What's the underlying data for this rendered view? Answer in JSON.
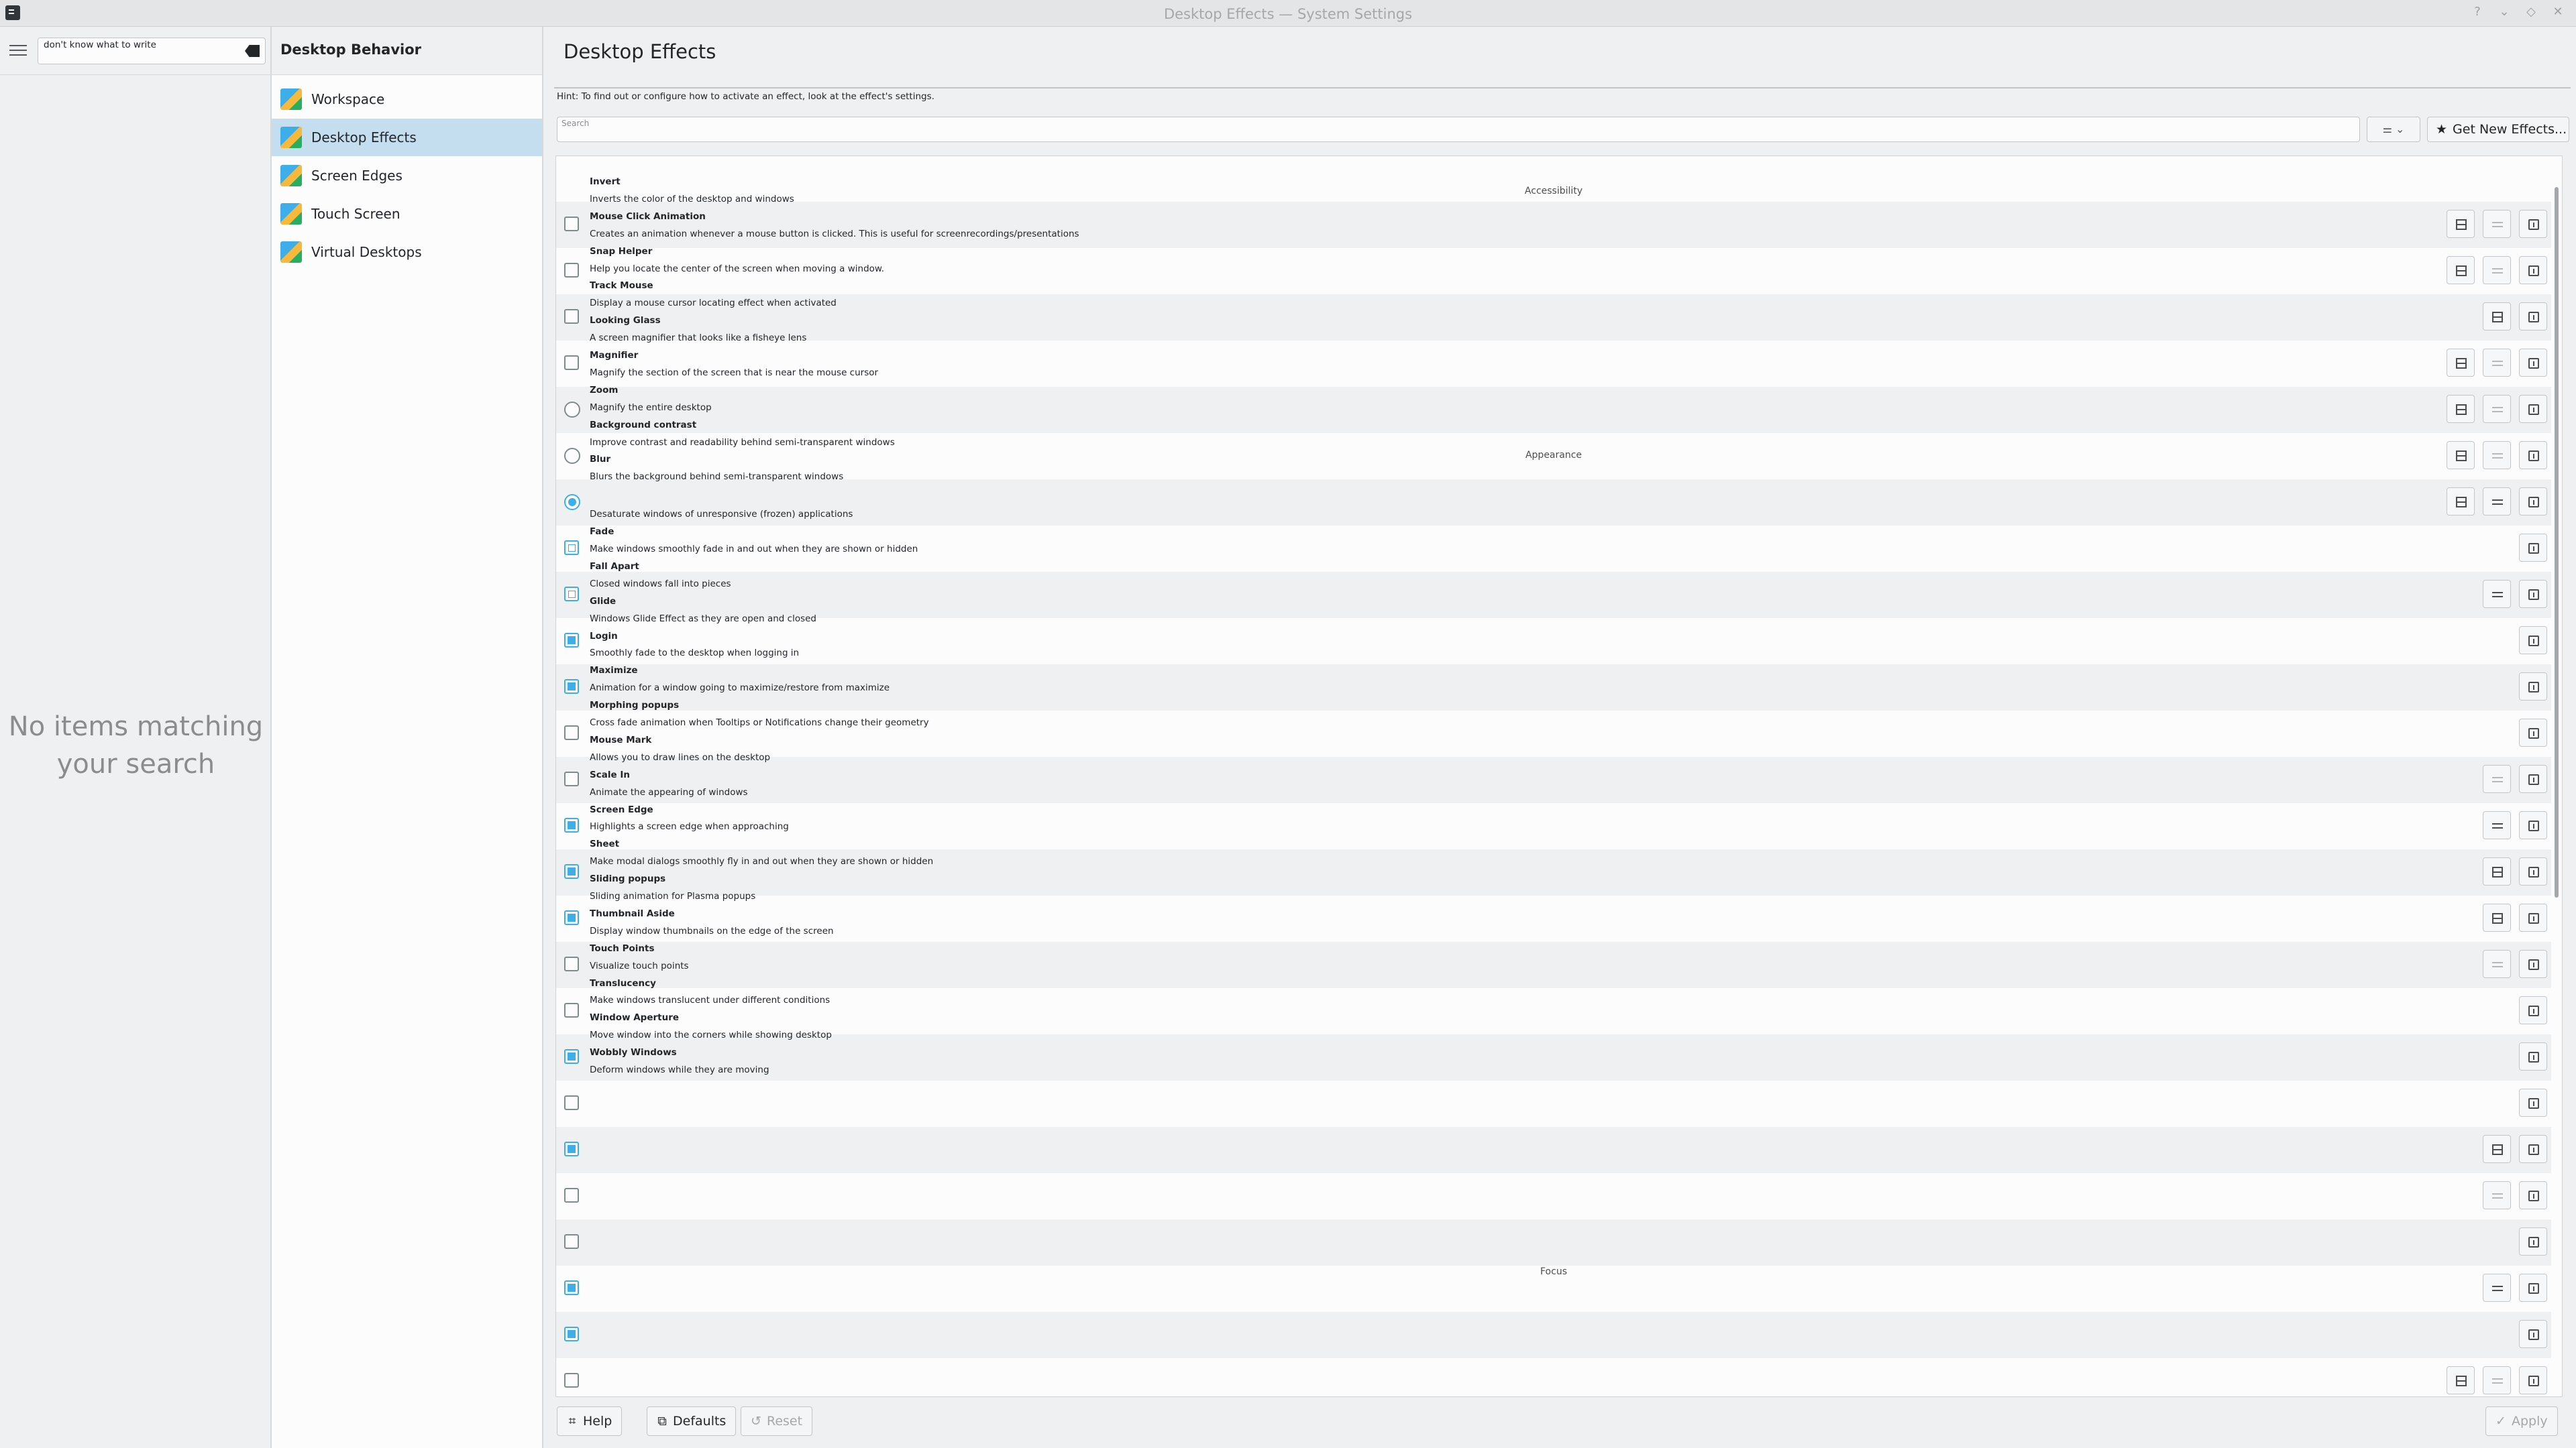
{
  "window": {
    "title": "Desktop Effects — System Settings",
    "controls": [
      "?",
      "⌄",
      "◇",
      "✕"
    ]
  },
  "sidebar": {
    "search_value": "don't know what to write",
    "no_items": "No items matching your search"
  },
  "categories": {
    "header": "Desktop Behavior",
    "items": [
      {
        "label": "Workspace",
        "selected": false
      },
      {
        "label": "Desktop Effects",
        "selected": true
      },
      {
        "label": "Screen Edges",
        "selected": false
      },
      {
        "label": "Touch Screen",
        "selected": false
      },
      {
        "label": "Virtual Desktops",
        "selected": false
      }
    ]
  },
  "main": {
    "title": "Desktop Effects",
    "hint": "Hint: To find out or configure how to activate an effect, look at the effect's settings.",
    "search_placeholder": "Search",
    "filter_glyph": "⚌ ⌄",
    "get_new_label": "Get New Effects...",
    "get_new_icon": "★"
  },
  "sections": {
    "accessibility": "Accessibility",
    "appearance": "Appearance",
    "focus": "Focus"
  },
  "texts": [
    {
      "text": "Invert",
      "bold": true
    },
    {
      "text": "Inverts the color of the desktop and windows",
      "bold": false
    },
    {
      "text": "Mouse Click Animation",
      "bold": true
    },
    {
      "text": "Creates an animation whenever a mouse button is clicked. This is useful for screenrecordings/presentations",
      "bold": false
    },
    {
      "text": "Snap Helper",
      "bold": true
    },
    {
      "text": "Help you locate the center of the screen when moving a window.",
      "bold": false
    },
    {
      "text": "Track Mouse",
      "bold": true
    },
    {
      "text": "Display a mouse cursor locating effect when activated",
      "bold": false
    },
    {
      "text": "Looking Glass",
      "bold": true
    },
    {
      "text": "A screen magnifier that looks like a fisheye lens",
      "bold": false
    },
    {
      "text": "Magnifier",
      "bold": true
    },
    {
      "text": "Magnify the section of the screen that is near the mouse cursor",
      "bold": false
    },
    {
      "text": "Zoom",
      "bold": true
    },
    {
      "text": "Magnify the entire desktop",
      "bold": false
    },
    {
      "text": "Background contrast",
      "bold": true
    },
    {
      "text": "Improve contrast and readability behind semi-transparent windows",
      "bold": false
    },
    {
      "text": "Blur",
      "bold": true
    },
    {
      "text": "Blurs the background behind semi-transparent windows",
      "bold": false
    },
    {
      "text": "Desaturate windows of unresponsive (frozen) applications",
      "bold": false
    },
    {
      "text": "Fade",
      "bold": true
    },
    {
      "text": "Make windows smoothly fade in and out when they are shown or hidden",
      "bold": false
    },
    {
      "text": "Fall Apart",
      "bold": true
    },
    {
      "text": "Closed windows fall into pieces",
      "bold": false
    },
    {
      "text": "Glide",
      "bold": true
    },
    {
      "text": "Windows Glide Effect as they are open and closed",
      "bold": false
    },
    {
      "text": "Login",
      "bold": true
    },
    {
      "text": "Smoothly fade to the desktop when logging in",
      "bold": false
    },
    {
      "text": "Maximize",
      "bold": true
    },
    {
      "text": "Animation for a window going to maximize/restore from maximize",
      "bold": false
    },
    {
      "text": "Morphing popups",
      "bold": true
    },
    {
      "text": "Cross fade animation when Tooltips or Notifications change their geometry",
      "bold": false
    },
    {
      "text": "Mouse Mark",
      "bold": true
    },
    {
      "text": "Allows you to draw lines on the desktop",
      "bold": false
    },
    {
      "text": "Scale In",
      "bold": true
    },
    {
      "text": "Animate the appearing of windows",
      "bold": false
    },
    {
      "text": "Screen Edge",
      "bold": true
    },
    {
      "text": "Highlights a screen edge when approaching",
      "bold": false
    },
    {
      "text": "Sheet",
      "bold": true
    },
    {
      "text": "Make modal dialogs smoothly fly in and out when they are shown or hidden",
      "bold": false
    },
    {
      "text": "Sliding popups",
      "bold": true
    },
    {
      "text": "Sliding animation for Plasma popups",
      "bold": false
    },
    {
      "text": "Thumbnail Aside",
      "bold": true
    },
    {
      "text": "Display window thumbnails on the edge of the screen",
      "bold": false
    },
    {
      "text": "Touch Points",
      "bold": true
    },
    {
      "text": "Visualize touch points",
      "bold": false
    },
    {
      "text": "Translucency",
      "bold": true
    },
    {
      "text": "Make windows translucent under different conditions",
      "bold": false
    },
    {
      "text": "Window Aperture",
      "bold": true
    },
    {
      "text": "Move window into the corners while showing desktop",
      "bold": false
    },
    {
      "text": "Wobbly Windows",
      "bold": true
    },
    {
      "text": "Deform windows while they are moving",
      "bold": false
    }
  ],
  "rows": [
    {
      "control": "checkbox",
      "state": "unchecked",
      "buttons": [
        "preview",
        "config-dim",
        "about"
      ]
    },
    {
      "control": "checkbox",
      "state": "unchecked",
      "buttons": [
        "preview",
        "config-dim",
        "about"
      ]
    },
    {
      "control": "checkbox",
      "state": "unchecked",
      "buttons": [
        "preview",
        "about"
      ]
    },
    {
      "control": "checkbox",
      "state": "unchecked",
      "buttons": [
        "preview",
        "config-dim",
        "about"
      ]
    },
    {
      "control": "radio",
      "state": "unchecked",
      "buttons": [
        "preview",
        "config-dim",
        "about"
      ]
    },
    {
      "control": "radio",
      "state": "unchecked",
      "buttons": [
        "preview",
        "config-dim",
        "about"
      ]
    },
    {
      "control": "radio",
      "state": "checked",
      "buttons": [
        "preview",
        "config",
        "about"
      ]
    },
    {
      "control": "checkbox",
      "state": "partial",
      "buttons": [
        "about"
      ]
    },
    {
      "control": "checkbox",
      "state": "partial",
      "buttons": [
        "config",
        "about"
      ]
    },
    {
      "control": "checkbox",
      "state": "checked",
      "buttons": [
        "about"
      ]
    },
    {
      "control": "checkbox",
      "state": "checked",
      "buttons": [
        "about"
      ]
    },
    {
      "control": "checkbox",
      "state": "unchecked",
      "buttons": [
        "about"
      ]
    },
    {
      "control": "checkbox",
      "state": "unchecked",
      "buttons": [
        "config-dim",
        "about"
      ]
    },
    {
      "control": "checkbox",
      "state": "checked",
      "buttons": [
        "config",
        "about"
      ]
    },
    {
      "control": "checkbox",
      "state": "checked",
      "buttons": [
        "preview",
        "about"
      ]
    },
    {
      "control": "checkbox",
      "state": "checked",
      "buttons": [
        "preview",
        "about"
      ]
    },
    {
      "control": "checkbox",
      "state": "unchecked",
      "buttons": [
        "config-dim",
        "about"
      ]
    },
    {
      "control": "checkbox",
      "state": "unchecked",
      "buttons": [
        "about"
      ]
    },
    {
      "control": "checkbox",
      "state": "checked",
      "buttons": [
        "about"
      ]
    },
    {
      "control": "checkbox",
      "state": "unchecked",
      "buttons": [
        "about"
      ]
    },
    {
      "control": "checkbox",
      "state": "checked",
      "buttons": [
        "preview",
        "about"
      ]
    },
    {
      "control": "checkbox",
      "state": "unchecked",
      "buttons": [
        "config-dim",
        "about"
      ]
    },
    {
      "control": "checkbox",
      "state": "unchecked",
      "buttons": [
        "about"
      ]
    },
    {
      "control": "checkbox",
      "state": "checked",
      "buttons": [
        "config",
        "about"
      ]
    },
    {
      "control": "checkbox",
      "state": "checked",
      "buttons": [
        "about"
      ]
    },
    {
      "control": "checkbox",
      "state": "unchecked",
      "buttons": [
        "preview",
        "config-dim",
        "about"
      ]
    }
  ],
  "footer": {
    "help": "Help",
    "help_icon": "⌗",
    "defaults": "Defaults",
    "defaults_icon": "⧉",
    "reset": "Reset",
    "reset_icon": "↺",
    "apply": "Apply",
    "apply_icon": "✓"
  },
  "colors": {
    "accent": "#3daee9",
    "selection": "#c4ddef",
    "window_bg": "#eff0f1",
    "view_bg": "#fcfcfc"
  }
}
